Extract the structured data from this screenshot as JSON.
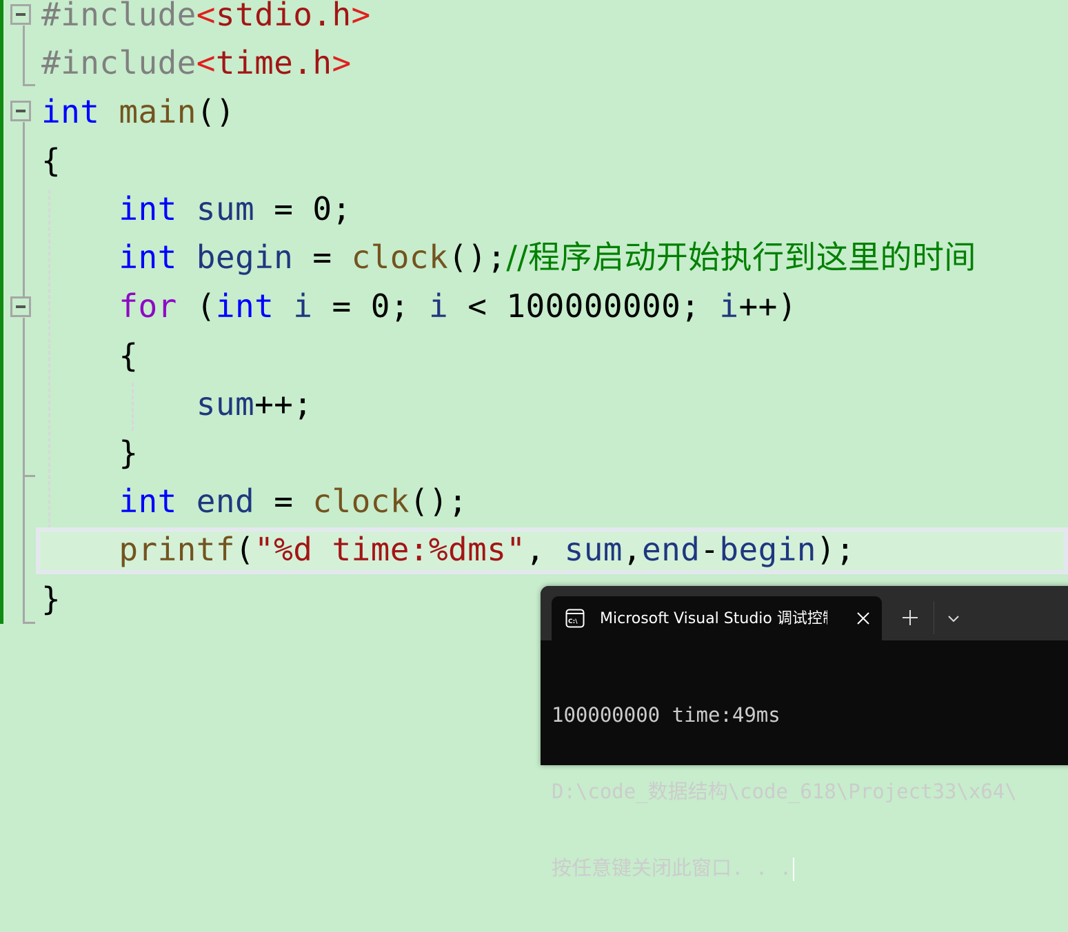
{
  "editor": {
    "lines": [
      {
        "tokens": [
          {
            "t": "#include",
            "c": "pp"
          },
          {
            "t": "<",
            "c": "ang"
          },
          {
            "t": "stdio.h",
            "c": "str"
          },
          {
            "t": ">",
            "c": "ang"
          }
        ]
      },
      {
        "tokens": [
          {
            "t": "#include",
            "c": "pp"
          },
          {
            "t": "<",
            "c": "ang"
          },
          {
            "t": "time.h",
            "c": "str"
          },
          {
            "t": ">",
            "c": "ang"
          }
        ]
      },
      {
        "tokens": [
          {
            "t": "int",
            "c": "kw"
          },
          {
            "t": " ",
            "c": "plain"
          },
          {
            "t": "main",
            "c": "fn"
          },
          {
            "t": "()",
            "c": "plain"
          }
        ]
      },
      {
        "tokens": [
          {
            "t": "{",
            "c": "plain"
          }
        ]
      },
      {
        "tokens": [
          {
            "t": "    ",
            "c": "plain"
          },
          {
            "t": "int",
            "c": "kw"
          },
          {
            "t": " ",
            "c": "plain"
          },
          {
            "t": "sum",
            "c": "var"
          },
          {
            "t": " = 0;",
            "c": "plain"
          }
        ]
      },
      {
        "tokens": [
          {
            "t": "    ",
            "c": "plain"
          },
          {
            "t": "int",
            "c": "kw"
          },
          {
            "t": " ",
            "c": "plain"
          },
          {
            "t": "begin",
            "c": "var"
          },
          {
            "t": " = ",
            "c": "plain"
          },
          {
            "t": "clock",
            "c": "fn"
          },
          {
            "t": "();",
            "c": "plain"
          },
          {
            "t": "//程序启动开始执行到这里的时间",
            "c": "cmt"
          }
        ]
      },
      {
        "tokens": [
          {
            "t": "    ",
            "c": "plain"
          },
          {
            "t": "for",
            "c": "ctl"
          },
          {
            "t": " (",
            "c": "plain"
          },
          {
            "t": "int",
            "c": "kw"
          },
          {
            "t": " ",
            "c": "plain"
          },
          {
            "t": "i",
            "c": "var"
          },
          {
            "t": " = 0; ",
            "c": "plain"
          },
          {
            "t": "i",
            "c": "var"
          },
          {
            "t": " < 100000000; ",
            "c": "plain"
          },
          {
            "t": "i",
            "c": "var"
          },
          {
            "t": "++)",
            "c": "plain"
          }
        ]
      },
      {
        "tokens": [
          {
            "t": "    {",
            "c": "plain"
          }
        ]
      },
      {
        "tokens": [
          {
            "t": "        ",
            "c": "plain"
          },
          {
            "t": "sum",
            "c": "var"
          },
          {
            "t": "++;",
            "c": "plain"
          }
        ]
      },
      {
        "tokens": [
          {
            "t": "    }",
            "c": "plain"
          }
        ]
      },
      {
        "tokens": [
          {
            "t": "    ",
            "c": "plain"
          },
          {
            "t": "int",
            "c": "kw"
          },
          {
            "t": " ",
            "c": "plain"
          },
          {
            "t": "end",
            "c": "var"
          },
          {
            "t": " = ",
            "c": "plain"
          },
          {
            "t": "clock",
            "c": "fn"
          },
          {
            "t": "();",
            "c": "plain"
          }
        ]
      },
      {
        "tokens": [
          {
            "t": "    ",
            "c": "plain"
          },
          {
            "t": "printf",
            "c": "fn"
          },
          {
            "t": "(",
            "c": "plain"
          },
          {
            "t": "\"%d time:%dms\"",
            "c": "str"
          },
          {
            "t": ", ",
            "c": "plain"
          },
          {
            "t": "sum",
            "c": "var"
          },
          {
            "t": ",",
            "c": "plain"
          },
          {
            "t": "end",
            "c": "var"
          },
          {
            "t": "-",
            "c": "plain"
          },
          {
            "t": "begin",
            "c": "var"
          },
          {
            "t": ");",
            "c": "plain"
          }
        ]
      },
      {
        "tokens": [
          {
            "t": "}",
            "c": "plain"
          }
        ]
      }
    ]
  },
  "console": {
    "tab_icon": "terminal-cmd-icon",
    "tab_title": "Microsoft Visual Studio 调试控制台",
    "close_icon": "close-icon",
    "new_tab_icon": "plus-icon",
    "dropdown_icon": "chevron-down-icon",
    "output": [
      "100000000 time:49ms",
      "D:\\code_数据结构\\code_618\\Project33\\x64\\",
      "按任意键关闭此窗口. . ."
    ]
  }
}
